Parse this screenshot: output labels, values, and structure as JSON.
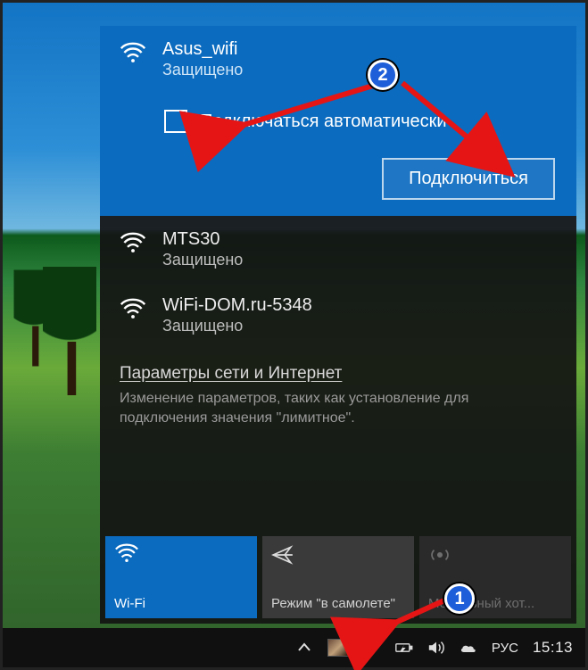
{
  "network_popup": {
    "selected": {
      "name": "Asus_wifi",
      "status": "Защищено",
      "auto_connect_label": "Подключаться автоматически",
      "connect_button": "Подключиться"
    },
    "others": [
      {
        "name": "MTS30",
        "status": "Защищено"
      },
      {
        "name": "WiFi-DOM.ru-5348",
        "status": "Защищено"
      }
    ],
    "settings": {
      "link": "Параметры сети и Интернет",
      "subtitle": "Изменение параметров, таких как установление для подключения значения \"лимитное\"."
    },
    "tiles": {
      "wifi": "Wi-Fi",
      "airplane": "Режим \"в самолете\"",
      "hotspot": "Мобильный хот..."
    }
  },
  "taskbar": {
    "language": "РУС",
    "time": "15:13"
  },
  "annotations": {
    "step1": "1",
    "step2": "2"
  }
}
